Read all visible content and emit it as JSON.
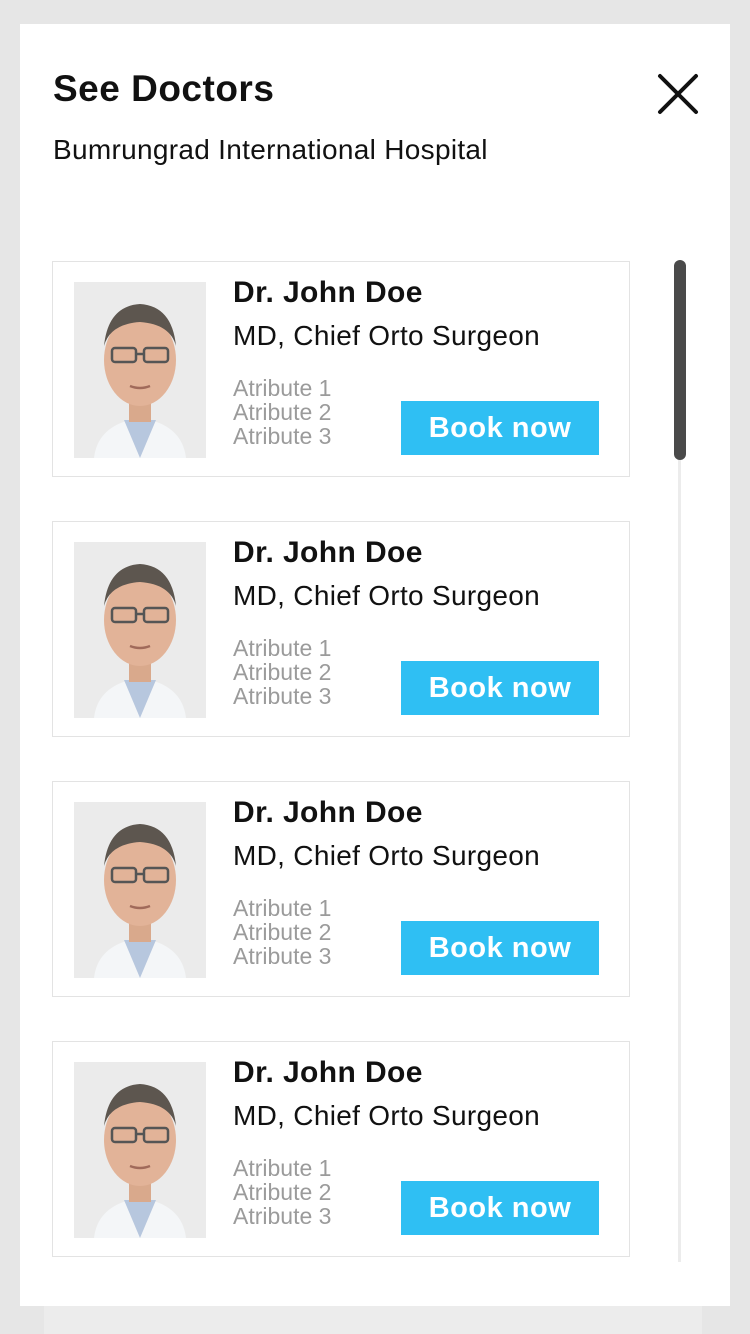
{
  "header": {
    "title": "See Doctors",
    "subtitle": "Bumrungrad International Hospital",
    "close_icon": "close-icon"
  },
  "accent_color": "#2fbff3",
  "doctors": [
    {
      "name": "Dr. John Doe",
      "role": "MD, Chief Orto Surgeon",
      "attributes": [
        "Atribute 1",
        "Atribute 2",
        "Atribute 3"
      ],
      "button_label": "Book now"
    },
    {
      "name": "Dr. John Doe",
      "role": "MD, Chief Orto Surgeon",
      "attributes": [
        "Atribute 1",
        "Atribute 2",
        "Atribute 3"
      ],
      "button_label": "Book now"
    },
    {
      "name": "Dr. John Doe",
      "role": "MD, Chief Orto Surgeon",
      "attributes": [
        "Atribute 1",
        "Atribute 2",
        "Atribute 3"
      ],
      "button_label": "Book now"
    },
    {
      "name": "Dr. John Doe",
      "role": "MD, Chief Orto Surgeon",
      "attributes": [
        "Atribute 1",
        "Atribute 2",
        "Atribute 3"
      ],
      "button_label": "Book now"
    }
  ]
}
